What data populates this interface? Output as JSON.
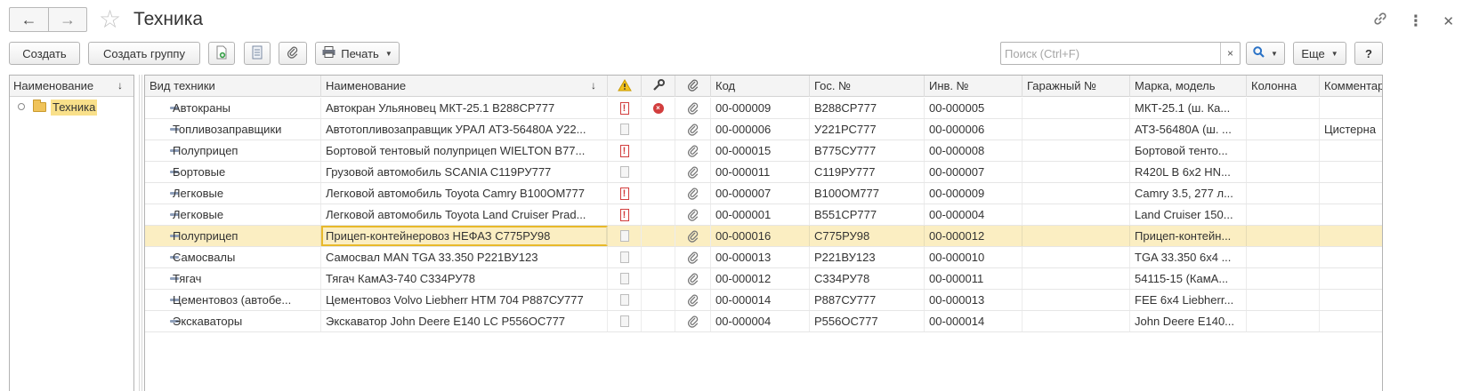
{
  "header": {
    "title": "Техника",
    "back_icon": "←",
    "forward_icon": "→",
    "star_icon": "☆",
    "link_icon": "🔗",
    "more_icon": "⋮",
    "close_icon": "✕"
  },
  "toolbar": {
    "create": "Создать",
    "create_group": "Создать группу",
    "print": "Печать",
    "more": "Еще",
    "help": "?",
    "search_placeholder": "Поиск (Ctrl+F)",
    "search_clear": "×",
    "search_icon": "🔍"
  },
  "tree": {
    "header": "Наименование",
    "sort_icon": "↓",
    "root_label": "Техника"
  },
  "grid": {
    "columns": {
      "kind": "Вид техники",
      "name": "Наименование",
      "name_sort": "↓",
      "warn_icon": "⚠",
      "tool_icon": "🔧",
      "clip_icon": "📎",
      "code": "Код",
      "gos": "Гос. №",
      "inv": "Инв. №",
      "garage": "Гаражный №",
      "model": "Марка, модель",
      "column": "Колонна",
      "comment": "Комментар"
    },
    "rows": [
      {
        "kind": "Автокраны",
        "name": "Автокран Ульяновец МКТ-25.1 В288СР777",
        "warn": true,
        "error": true,
        "code": "00-000009",
        "gos": "В288СР777",
        "inv": "00-000005",
        "garage": "",
        "model": "МКТ-25.1 (ш. Ка...",
        "column": "",
        "comment": ""
      },
      {
        "kind": "Топливозаправщики",
        "name": "Автотопливозаправщик УРАЛ АТЗ-56480А У22...",
        "warn": false,
        "error": false,
        "code": "00-000006",
        "gos": "У221РС777",
        "inv": "00-000006",
        "garage": "",
        "model": "АТЗ-56480А (ш. ...",
        "column": "",
        "comment": "Цистерна"
      },
      {
        "kind": "Полуприцеп",
        "name": "Бортовой тентовый полуприцеп WIELTON B77...",
        "warn": true,
        "error": false,
        "code": "00-000015",
        "gos": "В775СУ777",
        "inv": "00-000008",
        "garage": "",
        "model": "Бортовой тенто...",
        "column": "",
        "comment": ""
      },
      {
        "kind": "Бортовые",
        "name": "Грузовой автомобиль SCANIA С119РУ777",
        "warn": false,
        "error": false,
        "code": "00-000011",
        "gos": "С119РУ777",
        "inv": "00-000007",
        "garage": "",
        "model": "R420L B 6x2 HN...",
        "column": "",
        "comment": ""
      },
      {
        "kind": "Легковые",
        "name": "Легковой автомобиль Toyota Camry В100ОМ777",
        "warn": true,
        "error": false,
        "code": "00-000007",
        "gos": "В100ОМ777",
        "inv": "00-000009",
        "garage": "",
        "model": "Camry 3.5, 277 л...",
        "column": "",
        "comment": ""
      },
      {
        "kind": "Легковые",
        "name": "Легковой автомобиль Toyota Land Cruiser Prad...",
        "warn": true,
        "error": false,
        "code": "00-000001",
        "gos": "В551СР777",
        "inv": "00-000004",
        "garage": "",
        "model": "Land Cruiser 150...",
        "column": "",
        "comment": ""
      },
      {
        "kind": "Полуприцеп",
        "name": "Прицеп-контейнеровоз НЕФАЗ С775РУ98",
        "warn": false,
        "error": false,
        "code": "00-000016",
        "gos": "С775РУ98",
        "inv": "00-000012",
        "garage": "",
        "model": "Прицеп-контейн...",
        "column": "",
        "comment": "",
        "selected": true
      },
      {
        "kind": "Самосвалы",
        "name": "Самосвал MAN TGA 33.350 Р221ВУ123",
        "warn": false,
        "error": false,
        "code": "00-000013",
        "gos": " Р221ВУ123",
        "inv": "00-000010",
        "garage": "",
        "model": "TGA 33.350 6x4 ...",
        "column": "",
        "comment": ""
      },
      {
        "kind": "Тягач",
        "name": "Тягач КамАЗ-740 С334РУ78",
        "warn": false,
        "error": false,
        "code": "00-000012",
        "gos": "С334РУ78",
        "inv": "00-000011",
        "garage": "",
        "model": "54115-15 (КамА...",
        "column": "",
        "comment": ""
      },
      {
        "kind": "Цементовоз (автобе...",
        "name": "Цементовоз Volvo Liebherr HTM 704  Р887СУ777",
        "warn": false,
        "error": false,
        "code": "00-000014",
        "gos": "Р887СУ777",
        "inv": "00-000013",
        "garage": "",
        "model": "FEE 6x4 Liebherr...",
        "column": "",
        "comment": ""
      },
      {
        "kind": "Экскаваторы",
        "name": "Экскаватор John Deere E140 LC Р556ОС777",
        "warn": false,
        "error": false,
        "code": "00-000004",
        "gos": "Р556ОС777",
        "inv": "00-000014",
        "garage": "",
        "model": "John Deere E140...",
        "column": "",
        "comment": ""
      }
    ]
  },
  "colors": {
    "selected_row": "#fbeec2",
    "focus_border": "#e8b92a",
    "tree_highlight": "#f9e08a",
    "warning_red": "#d23d3d"
  }
}
